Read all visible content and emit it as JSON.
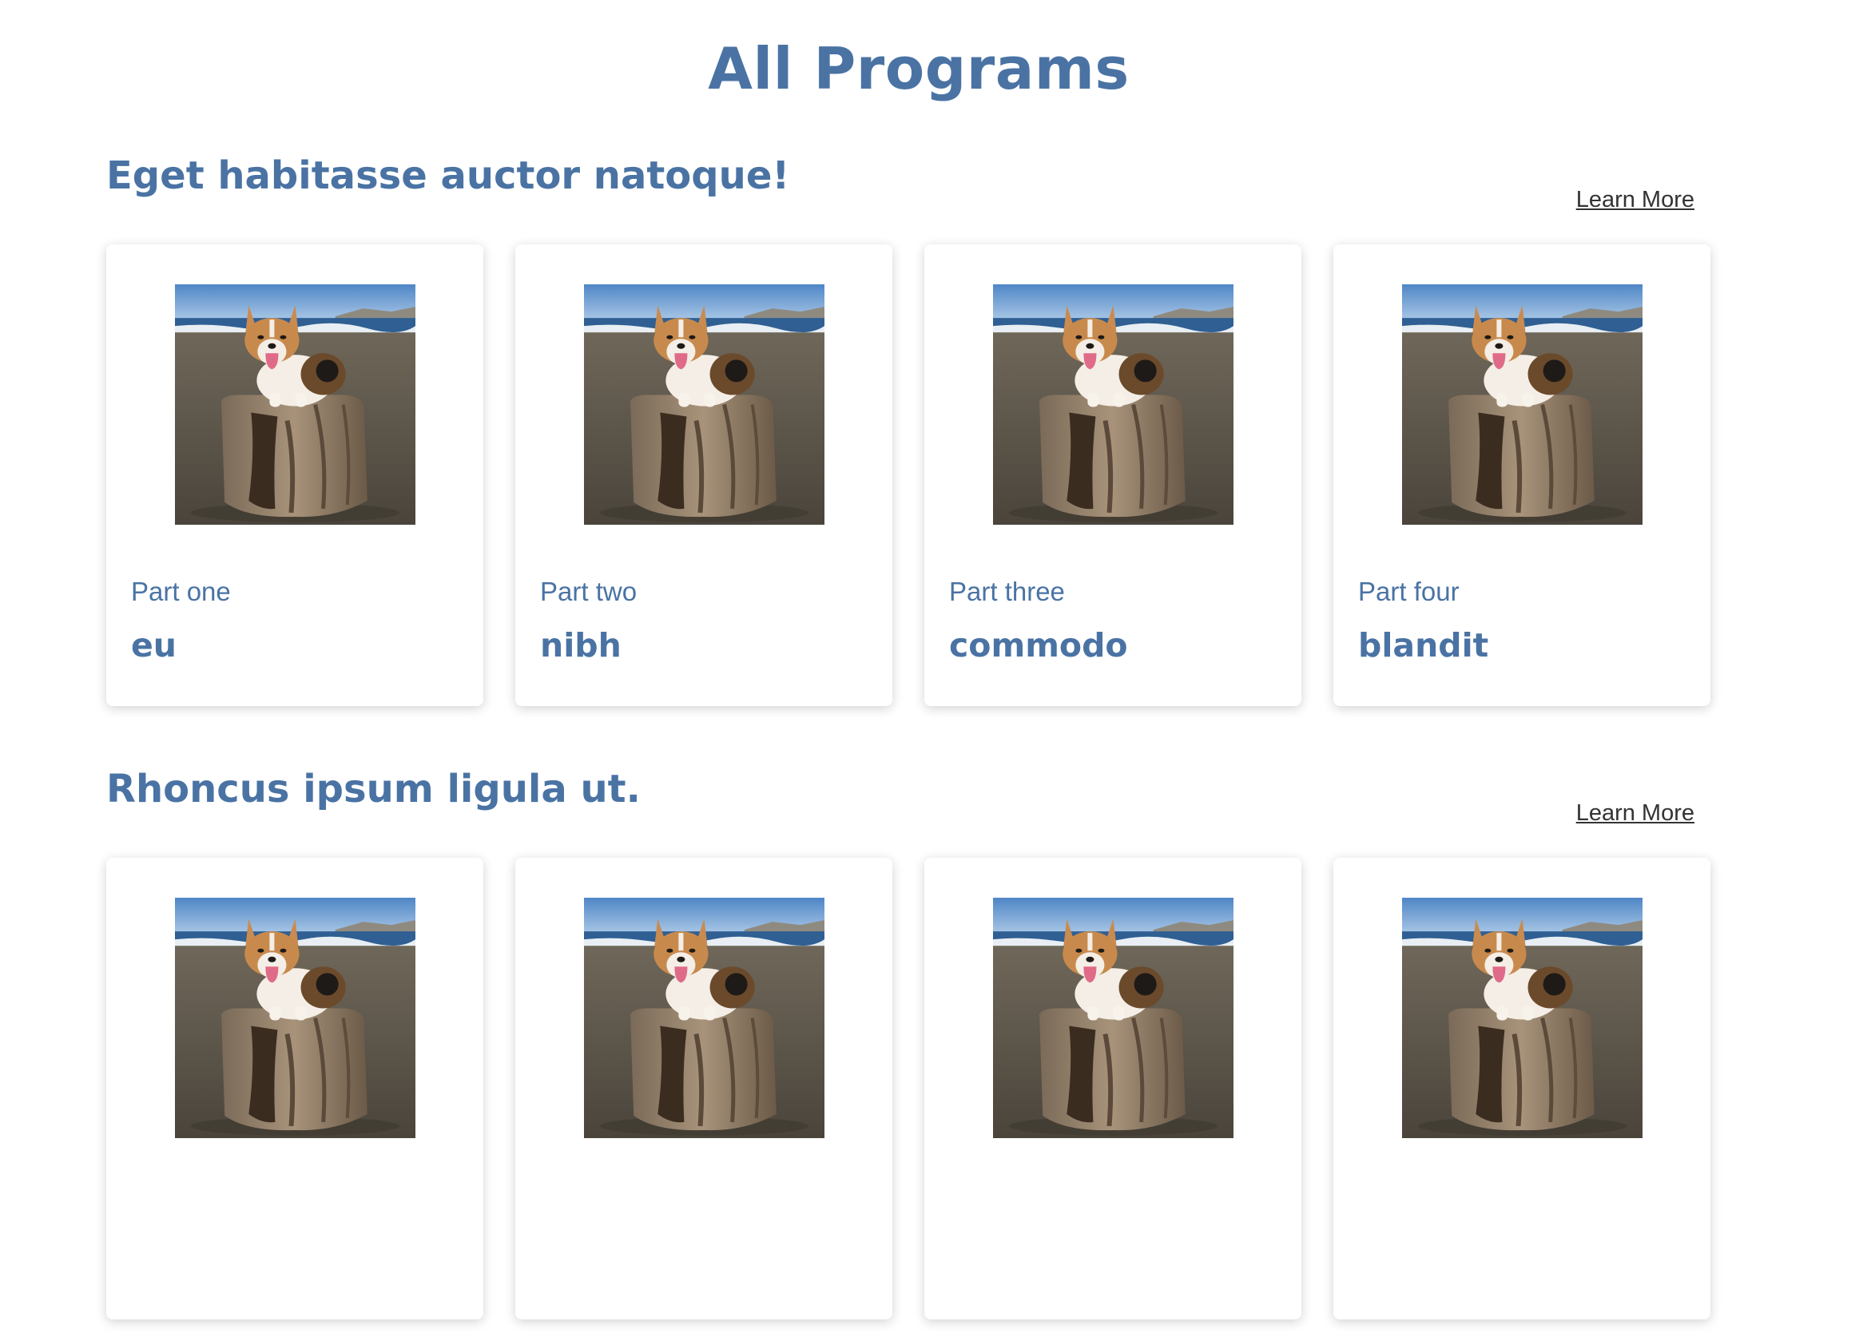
{
  "page": {
    "title": "All Programs"
  },
  "colors": {
    "heading": "#4a73a4",
    "link": "#333333",
    "card_bg": "#ffffff"
  },
  "sections": [
    {
      "title": "Eget habitasse auctor natoque!",
      "link_label": "Learn More",
      "cards": [
        {
          "part": "Part one",
          "word": "eu",
          "image": "corgi-on-driftwood-beach-photo"
        },
        {
          "part": "Part two",
          "word": "nibh",
          "image": "corgi-on-driftwood-beach-photo"
        },
        {
          "part": "Part three",
          "word": "commodo",
          "image": "corgi-on-driftwood-beach-photo"
        },
        {
          "part": "Part four",
          "word": "blandit",
          "image": "corgi-on-driftwood-beach-photo"
        }
      ]
    },
    {
      "title": "Rhoncus ipsum ligula ut.",
      "link_label": "Learn More",
      "cards": [
        {
          "image": "corgi-on-driftwood-beach-photo"
        },
        {
          "image": "corgi-on-driftwood-beach-photo"
        },
        {
          "image": "corgi-on-driftwood-beach-photo"
        },
        {
          "image": "corgi-on-driftwood-beach-photo"
        }
      ]
    }
  ]
}
